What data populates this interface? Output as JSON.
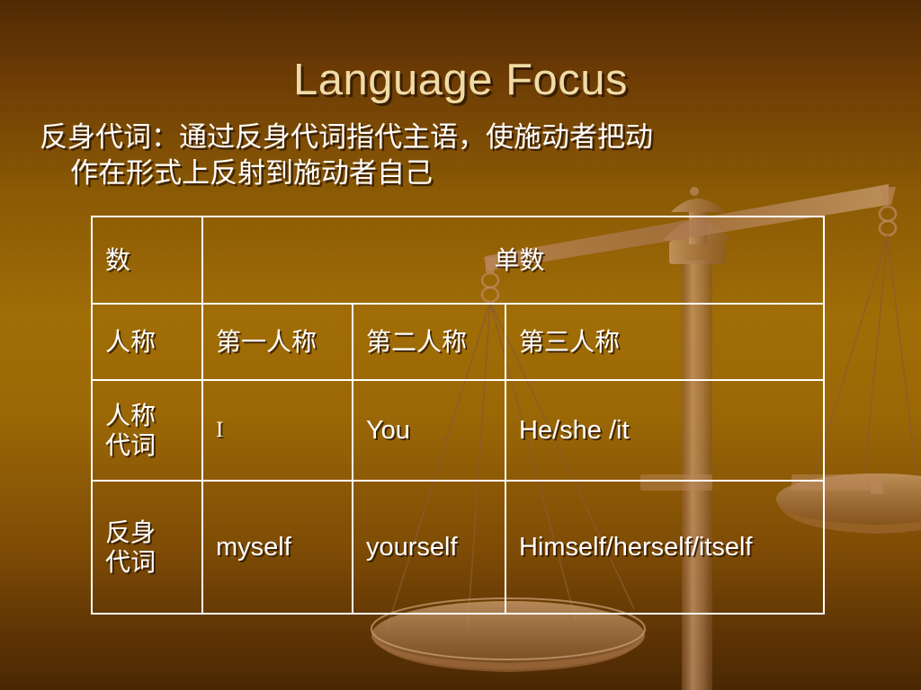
{
  "slide": {
    "title": "Language Focus",
    "subtitle_line1": "反身代词：通过反身代词指代主语，使施动者把动",
    "subtitle_line2": "作在形式上反射到施动者自己",
    "background_top_color": "#4f2a04",
    "background_mid_color": "#a06d06",
    "background_bottom_color": "#4a2804",
    "title_color": "#efdba6",
    "text_color": "#ffffff",
    "table_border_color": "#ffffff",
    "watermark_color": "#c08f5e"
  },
  "table": {
    "rows": [
      {
        "label": "数",
        "merged": true,
        "merged_value": "单数"
      },
      {
        "label": "人称",
        "first": "第一人称",
        "second": "第二人称",
        "third": "第三人称"
      },
      {
        "label": "人称\n代词",
        "first": "I",
        "second": "You",
        "third": "He/she /it"
      },
      {
        "label": "反身\n代词",
        "first": "myself",
        "second": "yourself",
        "third": "Himself/herself/itself"
      }
    ]
  },
  "decoration": {
    "watermark_name": "balance-scale"
  }
}
